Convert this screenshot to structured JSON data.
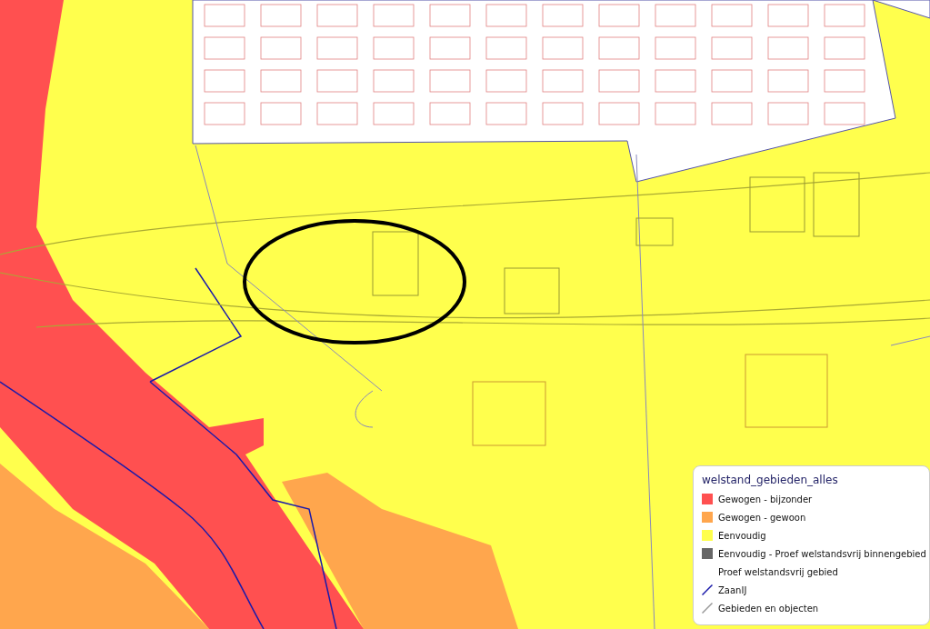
{
  "legend": {
    "title": "welstand_gebieden_alles",
    "items": [
      {
        "kind": "swatch",
        "label": "Gewogen - bijzonder",
        "color": "#ff5050"
      },
      {
        "kind": "swatch",
        "label": "Gewogen - gewoon",
        "color": "#ffa64d"
      },
      {
        "kind": "swatch",
        "label": "Eenvoudig",
        "color": "#ffff4d"
      },
      {
        "kind": "swatch",
        "label": "Eenvoudig - Proef welstandsvrij binnengebied",
        "color": "#666666"
      },
      {
        "kind": "none",
        "label": "Proef welstandsvrij gebied"
      },
      {
        "kind": "line",
        "label": "ZaanIJ",
        "color": "#1a1aaa"
      },
      {
        "kind": "line",
        "label": "Gebieden en objecten",
        "color": "#999999"
      }
    ]
  }
}
